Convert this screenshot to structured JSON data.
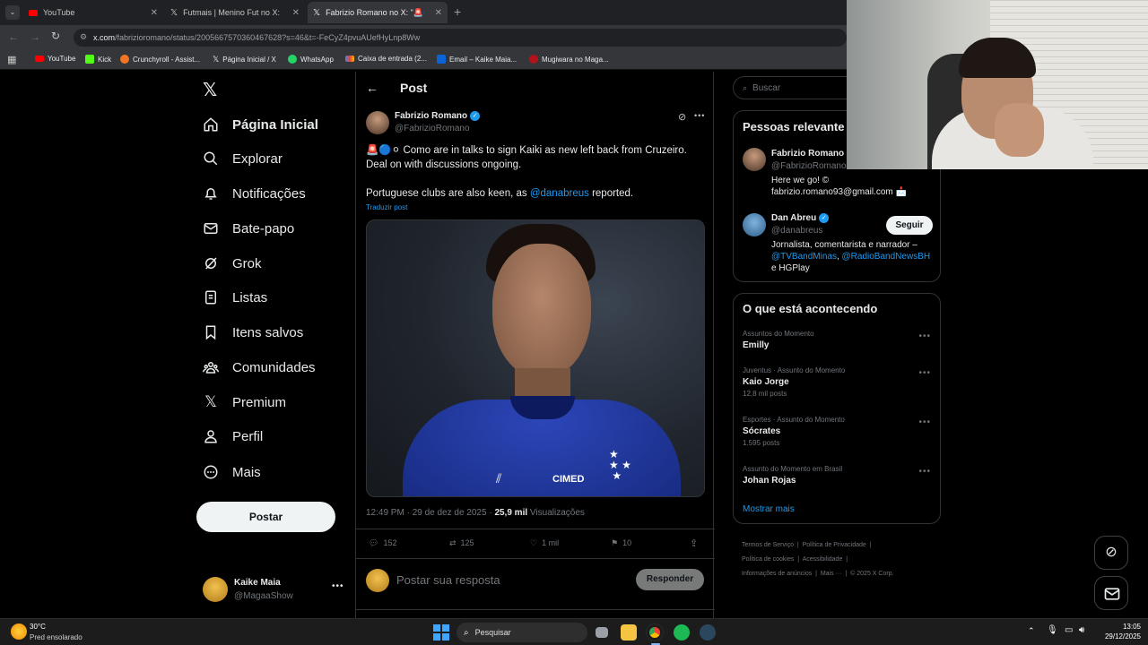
{
  "browser": {
    "tabs": [
      {
        "title": "YouTube"
      },
      {
        "title": "Futmais | Menino Fut no X: \"Ou"
      },
      {
        "title": "Fabrizio Romano no X: \"🚨🔵⚪"
      }
    ],
    "url_host": "x.com",
    "url_path": "/fabrizioromano/status/2005667570360467628?s=46&t=-FeCyZ4pvuAUefHyLnp8Ww",
    "bookmarks": [
      "YouTube",
      "Kick",
      "Crunchyroll - Assist...",
      "Página Inicial / X",
      "WhatsApp",
      "Caixa de entrada (2...",
      "Email – Kaike Maia...",
      "Mugiwara no Maga..."
    ]
  },
  "nav": {
    "items": [
      {
        "label": "Página Inicial",
        "icon": "home-icon"
      },
      {
        "label": "Explorar",
        "icon": "search-icon"
      },
      {
        "label": "Notificações",
        "icon": "bell-icon"
      },
      {
        "label": "Bate-papo",
        "icon": "mail-icon"
      },
      {
        "label": "Grok",
        "icon": "grok-icon"
      },
      {
        "label": "Listas",
        "icon": "list-icon"
      },
      {
        "label": "Itens salvos",
        "icon": "bookmark-icon"
      },
      {
        "label": "Comunidades",
        "icon": "communities-icon"
      },
      {
        "label": "Premium",
        "icon": "x-logo-icon"
      },
      {
        "label": "Perfil",
        "icon": "person-icon"
      },
      {
        "label": "Mais",
        "icon": "more-icon"
      }
    ],
    "post_button": "Postar",
    "account": {
      "name": "Kaike Maia",
      "handle": "@MagaaShow"
    }
  },
  "post": {
    "header": "Post",
    "author_name": "Fabrizio Romano",
    "author_handle": "@FabrizioRomano",
    "text_line1": "🚨🔵⚪ Como are in talks to sign Kaiki as new left back from Cruzeiro. Deal on with discussions ongoing.",
    "text_line2_prefix": "Portuguese clubs are also keen, as ",
    "text_mention": "@danabreus",
    "text_line2_suffix": " reported.",
    "translate": "Traduzir post",
    "jersey_sponsor": "CIMED",
    "timestamp": "12:49 PM · 29 de dez de 2025 · ",
    "views_count": "25,9 mil",
    "views_label": " Visualizações",
    "replies": "152",
    "reposts": "125",
    "likes": "1 mil",
    "bookmarks": "10",
    "reply_placeholder": "Postar sua resposta",
    "reply_button": "Responder"
  },
  "sidebar": {
    "search_placeholder": "Buscar",
    "relevant_title": "Pessoas relevante",
    "people": [
      {
        "name": "Fabrizio Romano",
        "handle": "@FabrizioRomano",
        "bio": "Here we go! © fabrizio.romano93@gmail.com 📩"
      },
      {
        "name": "Dan Abreu",
        "handle": "@danabreus",
        "follow": "Seguir",
        "bio_prefix": "Jornalista, comentarista e narrador – ",
        "bio_link1": "@TVBandMinas",
        "bio_sep": ", ",
        "bio_link2": "@RadioBandNewsBH",
        "bio_suffix": " e HGPlay"
      }
    ],
    "happening_title": "O que está acontecendo",
    "trends": [
      {
        "category": "Assuntos do Momento",
        "name": "Emilly",
        "count": ""
      },
      {
        "category": "Juventus · Assunto do Momento",
        "name": "Kaio Jorge",
        "count": "12,8 mil posts"
      },
      {
        "category": "Esportes · Assunto do Momento",
        "name": "Sócrates",
        "count": "1.595 posts"
      },
      {
        "category": "Assunto do Momento em Brasil",
        "name": "Johan Rojas",
        "count": ""
      }
    ],
    "show_more": "Mostrar mais",
    "footer": [
      "Termos de Serviço",
      "Política de Privacidade",
      "Política de cookies",
      "Acessibilidade",
      "Informações de anúncios",
      "Mais ···",
      "© 2025 X Corp."
    ]
  },
  "taskbar": {
    "weather_temp": "30°C",
    "weather_desc": "Pred ensolarado",
    "search": "Pesquisar",
    "time": "13:05",
    "date": "29/12/2025"
  }
}
